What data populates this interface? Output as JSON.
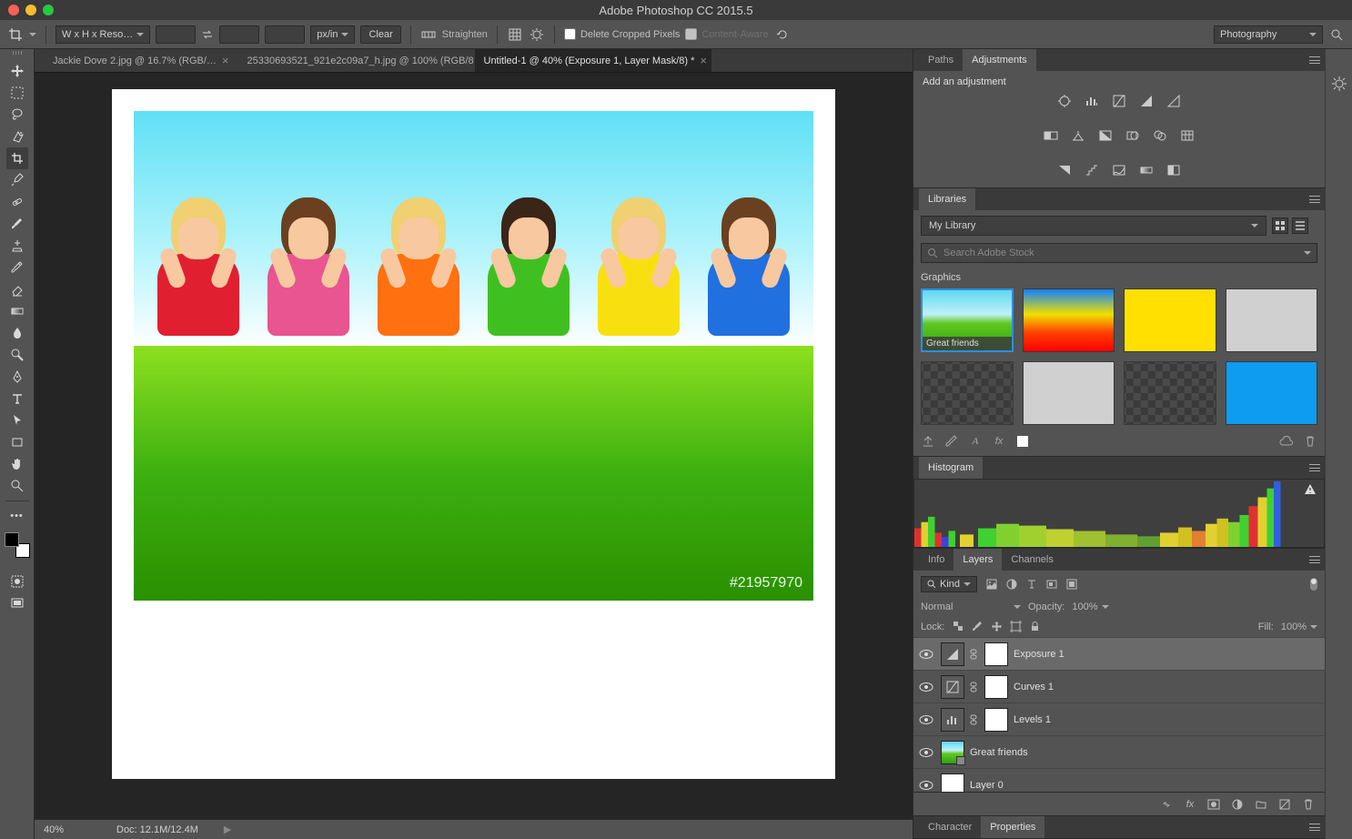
{
  "app_title": "Adobe Photoshop CC 2015.5",
  "workspace": "Photography",
  "options_bar": {
    "tool_preset": "W x H x Reso…",
    "unit": "px/in",
    "clear": "Clear",
    "straighten": "Straighten",
    "delete_cropped": "Delete Cropped Pixels",
    "content_aware": "Content-Aware"
  },
  "doc_tabs": [
    {
      "label": "Jackie Dove 2.jpg @ 16.7% (RGB/…",
      "active": false
    },
    {
      "label": "25330693521_921e2c09a7_h.jpg @ 100% (RGB/8…",
      "active": false
    },
    {
      "label": "Untitled-1 @ 40% (Exposure 1, Layer Mask/8) *",
      "active": true
    }
  ],
  "canvas": {
    "image_id": "#21957970"
  },
  "status": {
    "zoom": "40%",
    "doc": "Doc: 12.1M/12.4M"
  },
  "panels": {
    "paths_adjustments": {
      "tabs": [
        "Paths",
        "Adjustments"
      ],
      "active": 1,
      "label": "Add an adjustment"
    },
    "libraries": {
      "tab": "Libraries",
      "selected": "My Library",
      "search_placeholder": "Search Adobe Stock",
      "section": "Graphics",
      "items": [
        {
          "name": "Great friends",
          "style": "thumb-kids",
          "selected": true
        },
        {
          "name": "",
          "style": "thumb-kids-sat"
        },
        {
          "name": "",
          "style": "thumb-yellow"
        },
        {
          "name": "",
          "style": "thumb-gray"
        },
        {
          "name": "",
          "style": "lib-trans"
        },
        {
          "name": "",
          "style": "thumb-gray"
        },
        {
          "name": "",
          "style": "lib-trans"
        },
        {
          "name": "",
          "style": "thumb-blue"
        }
      ]
    },
    "histogram": {
      "tab": "Histogram"
    },
    "layers": {
      "tabs": [
        "Info",
        "Layers",
        "Channels"
      ],
      "active": 1,
      "kind": "Kind",
      "blend": "Normal",
      "opacity_label": "Opacity:",
      "opacity": "100%",
      "lock_label": "Lock:",
      "fill_label": "Fill:",
      "fill": "100%",
      "items": [
        {
          "name": "Exposure 1",
          "type": "adj",
          "selected": true,
          "icon": "exposure"
        },
        {
          "name": "Curves 1",
          "type": "adj",
          "icon": "curves"
        },
        {
          "name": "Levels 1",
          "type": "adj",
          "icon": "levels"
        },
        {
          "name": "Great friends",
          "type": "smart"
        },
        {
          "name": "Layer 0",
          "type": "pixel"
        }
      ]
    },
    "bottom_tabs": {
      "tabs": [
        "Character",
        "Properties"
      ],
      "active": 1
    }
  }
}
